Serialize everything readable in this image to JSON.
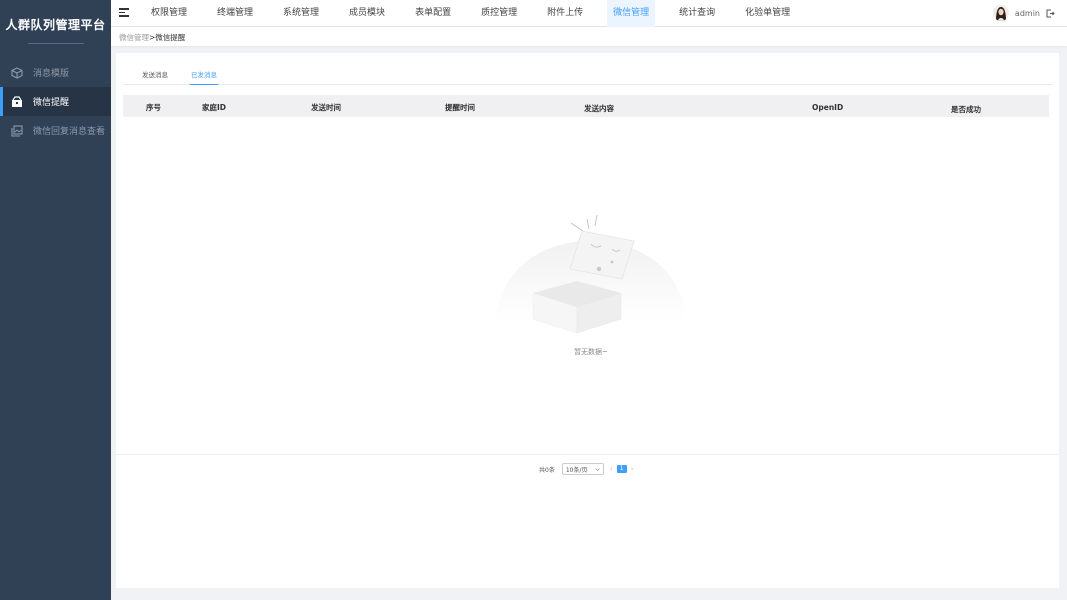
{
  "app": {
    "brand": "人群队列管理平台"
  },
  "sidebar": {
    "items": [
      {
        "label": "消息模版",
        "icon": "cube-icon",
        "active": false
      },
      {
        "label": "微信提醒",
        "icon": "box-icon",
        "active": true
      },
      {
        "label": "微信回复消息查看",
        "icon": "gallery-icon",
        "active": false
      }
    ]
  },
  "header": {
    "nav": [
      {
        "label": "权限管理"
      },
      {
        "label": "终端管理"
      },
      {
        "label": "系统管理"
      },
      {
        "label": "成员模块"
      },
      {
        "label": "表单配置"
      },
      {
        "label": "质控管理"
      },
      {
        "label": "附件上传"
      },
      {
        "label": "微信管理",
        "active": true
      },
      {
        "label": "统计查询"
      },
      {
        "label": "化验单管理"
      }
    ],
    "user": "admin"
  },
  "breadcrumb": {
    "parent": "微信管理",
    "separator": ">",
    "current": "微信提醒"
  },
  "tabs": [
    {
      "label": "发送消息"
    },
    {
      "label": "已发消息",
      "active": true
    }
  ],
  "table": {
    "columns": [
      "序号",
      "家庭ID",
      "发送时间",
      "提醒时间",
      "发送内容",
      "OpenID",
      "是否成功"
    ],
    "rows": [],
    "empty_text": "暂无数据~"
  },
  "pagination": {
    "total": "共0条",
    "page_size": "10条/页",
    "prev": "‹",
    "next": "›",
    "current_page": "1"
  },
  "colors": {
    "sidebar_bg": "#304156",
    "accent": "#409eff"
  }
}
